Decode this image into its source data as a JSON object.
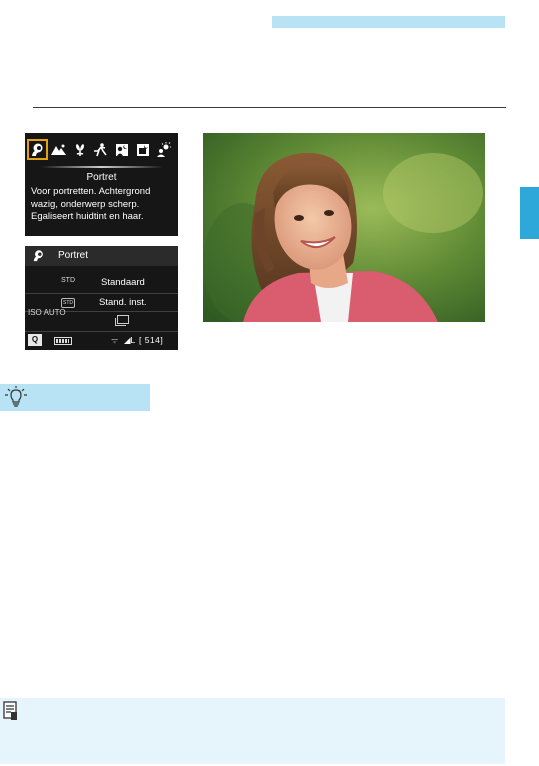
{
  "colors": {
    "accent_light_blue": "#b7e3f5",
    "side_tab_blue": "#2ea8d8",
    "note_bg": "#e6f4fc",
    "selection_orange": "#e3a20f",
    "camera_screen_bg": "#161616"
  },
  "screen1": {
    "mode_icons": [
      "portrait-mode-icon",
      "landscape-mode-icon",
      "closeup-mode-icon",
      "sports-mode-icon",
      "night-portrait-mode-icon",
      "handheld-night-mode-icon",
      "hdr-backlight-mode-icon"
    ],
    "selected_mode": "portrait-mode-icon",
    "mode_title": "Portret",
    "description": "Voor portretten. Achtergrond wazig, onderwerp scherp. Egaliseert huidtint en haar."
  },
  "screen2": {
    "title": "Portret",
    "iso": "ISO AUTO",
    "picture_style_icon": "STD",
    "picture_style": "Standaard",
    "ambience_icon": "STD",
    "ambience": "Stand. inst.",
    "q_label": "Q",
    "quality": "◢L",
    "shots_remaining": "[ 514]"
  },
  "photo": {
    "icon": "portrait-photo"
  },
  "tip": {
    "icon": "lightbulb-icon"
  },
  "note": {
    "icon": "memo-icon"
  }
}
